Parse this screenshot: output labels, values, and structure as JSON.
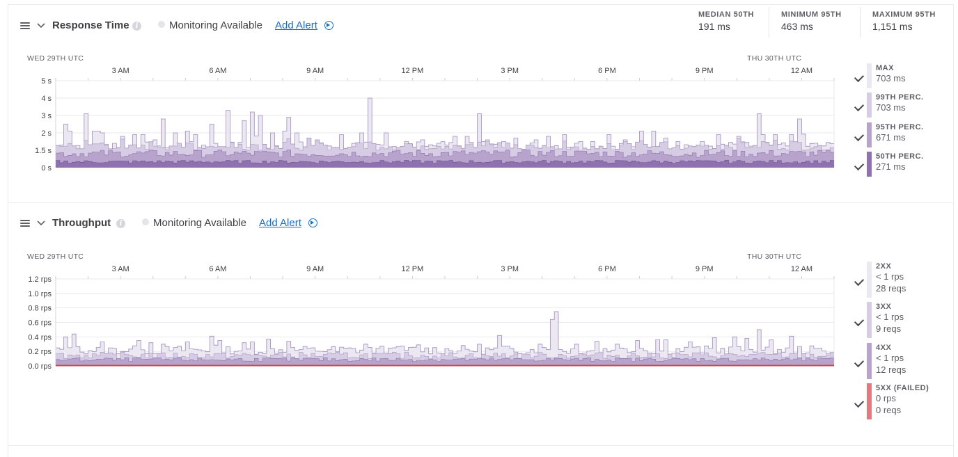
{
  "response_time": {
    "title": "Response Time",
    "monitoring_label": "Monitoring Available",
    "add_alert_label": "Add Alert",
    "stats": [
      {
        "label": "MEDIAN 50TH",
        "value": "191 ms"
      },
      {
        "label": "MINIMUM 95TH",
        "value": "463 ms"
      },
      {
        "label": "MAXIMUM 95TH",
        "value": "1,151 ms"
      }
    ],
    "legend": [
      {
        "name": "MAX",
        "lines": [
          "703 ms"
        ],
        "color": "#ece8f2"
      },
      {
        "name": "99TH PERC.",
        "lines": [
          "703 ms"
        ],
        "color": "#d6cce3"
      },
      {
        "name": "95TH PERC.",
        "lines": [
          "671 ms"
        ],
        "color": "#b7a3cc"
      },
      {
        "name": "50TH PERC.",
        "lines": [
          "271 ms"
        ],
        "color": "#8e72b0"
      }
    ]
  },
  "throughput": {
    "title": "Throughput",
    "monitoring_label": "Monitoring Available",
    "add_alert_label": "Add Alert",
    "legend": [
      {
        "name": "2XX",
        "lines": [
          "< 1 rps",
          "28 reqs"
        ],
        "color": "#ece8f2"
      },
      {
        "name": "3XX",
        "lines": [
          "< 1 rps",
          "9 reqs"
        ],
        "color": "#d6cce3"
      },
      {
        "name": "4XX",
        "lines": [
          "< 1 rps",
          "12 reqs"
        ],
        "color": "#b7a3cc"
      },
      {
        "name": "5XX (FAILED)",
        "lines": [
          "0 rps",
          "0 reqs"
        ],
        "color": "#e07a80"
      }
    ]
  },
  "chart_data": [
    {
      "type": "area",
      "title": "Response Time",
      "date_labels": [
        "WED 29TH UTC",
        "THU 30TH UTC"
      ],
      "x_tick_labels": [
        "3 AM",
        "6 AM",
        "9 AM",
        "12 PM",
        "3 PM",
        "6 PM",
        "9 PM",
        "12 AM"
      ],
      "y_tick_labels": [
        "0 s",
        "1.5 s",
        "2 s",
        "3 s",
        "4 s",
        "5 s"
      ],
      "ylim": [
        0,
        5
      ],
      "grid": true,
      "series": [
        {
          "name": "MAX",
          "color": "#ece8f2",
          "spikes": [
            [
              0.27,
              2.5
            ],
            [
              0.41,
              2.1
            ],
            [
              0.85,
              3.1
            ],
            [
              1.08,
              1.9
            ],
            [
              1.17,
              2.1
            ],
            [
              1.25,
              2.1
            ],
            [
              1.35,
              2.0
            ],
            [
              1.78,
              1.4
            ],
            [
              2.05,
              1.8
            ],
            [
              2.35,
              1.9
            ],
            [
              2.61,
              1.9
            ],
            [
              3.0,
              1.6
            ],
            [
              3.22,
              2.8
            ],
            [
              3.65,
              2.0
            ],
            [
              3.72,
              1.4
            ],
            [
              4.05,
              2.1
            ],
            [
              4.27,
              1.9
            ],
            [
              4.7,
              2.5
            ],
            [
              5.23,
              3.3
            ],
            [
              5.73,
              2.7
            ],
            [
              6.0,
              3.2
            ],
            [
              6.28,
              3.0
            ],
            [
              6.62,
              2.0
            ],
            [
              6.95,
              2.1
            ],
            [
              7.1,
              2.9
            ],
            [
              7.42,
              2.0
            ],
            [
              7.7,
              1.7
            ],
            [
              8.0,
              1.6
            ],
            [
              8.27,
              1.3
            ],
            [
              8.8,
              1.9
            ],
            [
              9.38,
              2.0
            ],
            [
              9.63,
              4.0
            ],
            [
              10.13,
              2.0
            ],
            [
              10.7,
              1.5
            ],
            [
              11.27,
              1.6
            ],
            [
              11.7,
              1.4
            ],
            [
              12.0,
              1.3
            ],
            [
              12.27,
              1.8
            ],
            [
              12.57,
              1.8
            ],
            [
              13.0,
              3.1
            ],
            [
              13.3,
              1.6
            ],
            [
              13.73,
              1.5
            ],
            [
              14.18,
              1.7
            ],
            [
              14.73,
              1.6
            ],
            [
              15.12,
              1.8
            ],
            [
              15.6,
              1.9
            ],
            [
              16.07,
              1.5
            ],
            [
              16.51,
              1.5
            ],
            [
              17.05,
              1.9
            ],
            [
              17.5,
              1.6
            ],
            [
              17.98,
              2.1
            ],
            [
              18.32,
              2.1
            ],
            [
              18.69,
              1.7
            ],
            [
              19.07,
              1.5
            ],
            [
              19.85,
              1.5
            ],
            [
              20.37,
              1.9
            ],
            [
              21.05,
              1.8
            ],
            [
              21.6,
              3.1
            ],
            [
              22.15,
              1.9
            ],
            [
              22.67,
              1.9
            ],
            [
              22.85,
              2.8
            ]
          ]
        },
        {
          "name": "99TH PERC.",
          "color": "#d6cce3",
          "baseline": 1.0
        },
        {
          "name": "95TH PERC.",
          "color": "#b7a3cc",
          "baseline": 0.6
        },
        {
          "name": "50TH PERC.",
          "color": "#8e72b0",
          "baseline": 0.25
        }
      ]
    },
    {
      "type": "area",
      "title": "Throughput",
      "date_labels": [
        "WED 29TH UTC",
        "THU 30TH UTC"
      ],
      "x_tick_labels": [
        "3 AM",
        "6 AM",
        "9 AM",
        "12 PM",
        "3 PM",
        "6 PM",
        "9 PM",
        "12 AM"
      ],
      "y_tick_labels": [
        "0.0 rps",
        "0.2 rps",
        "0.4 rps",
        "0.6 rps",
        "0.8 rps",
        "1.0 rps",
        "1.2 rps"
      ],
      "ylim": [
        0,
        1.2
      ],
      "grid": true,
      "series": [
        {
          "name": "2XX",
          "color": "#ece8f2",
          "spikes": [
            [
              0.28,
              0.4
            ],
            [
              0.52,
              0.44
            ],
            [
              1.35,
              0.33
            ],
            [
              2.45,
              0.35
            ],
            [
              2.9,
              0.32
            ],
            [
              3.3,
              0.3
            ],
            [
              4.05,
              0.33
            ],
            [
              4.7,
              0.41
            ],
            [
              5.05,
              0.35
            ],
            [
              5.73,
              0.32
            ],
            [
              6.0,
              0.33
            ],
            [
              6.55,
              0.37
            ],
            [
              7.1,
              0.34
            ],
            [
              7.9,
              0.25
            ],
            [
              8.65,
              0.2
            ],
            [
              9.55,
              0.3
            ],
            [
              10.35,
              0.25
            ],
            [
              11.07,
              0.29
            ],
            [
              12.55,
              0.28
            ],
            [
              13.05,
              0.3
            ],
            [
              13.65,
              0.42
            ],
            [
              14.82,
              0.3
            ],
            [
              15.2,
              0.64
            ],
            [
              15.42,
              0.75
            ],
            [
              15.95,
              0.3
            ],
            [
              16.65,
              0.34
            ],
            [
              17.3,
              0.3
            ],
            [
              17.9,
              0.35
            ],
            [
              18.47,
              0.36
            ],
            [
              18.75,
              0.36
            ],
            [
              19.5,
              0.33
            ],
            [
              20.25,
              0.39
            ],
            [
              20.85,
              0.4
            ],
            [
              21.28,
              0.38
            ],
            [
              21.6,
              0.5
            ],
            [
              21.95,
              0.36
            ],
            [
              22.62,
              0.41
            ]
          ]
        },
        {
          "name": "3XX",
          "color": "#d6cce3",
          "baseline": 0.1
        },
        {
          "name": "4XX",
          "color": "#b7a3cc",
          "baseline": 0.06
        },
        {
          "name": "5XX (FAILED)",
          "color": "#e07a80",
          "baseline": 0.0
        }
      ]
    }
  ]
}
